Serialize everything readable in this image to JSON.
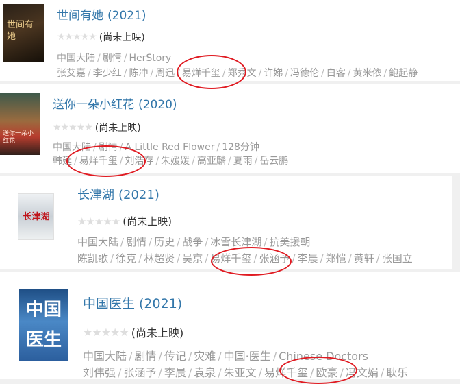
{
  "movies": [
    {
      "title": "世间有她",
      "year": "(2021)",
      "poster_text": "世间有她",
      "stars": "★★★★★",
      "status": "(尚未上映)",
      "meta": [
        "中国大陆",
        "剧情",
        "HerStory"
      ],
      "cast": [
        "张艾嘉",
        "李少红",
        "陈冲",
        "周迅",
        "易烊千玺",
        "郑秀文",
        "许娣",
        "冯德伦",
        "白客",
        "黄米依",
        "鲍起静"
      ]
    },
    {
      "title": "送你一朵小红花",
      "year": "(2020)",
      "poster_text": "送你一朵小红花",
      "stars": "★★★★★",
      "status": "(尚未上映)",
      "meta": [
        "中国大陆",
        "剧情",
        "A Little Red Flower",
        "128分钟"
      ],
      "cast": [
        "韩延",
        "易烊千玺",
        "刘浩存",
        "朱媛媛",
        "高亚麟",
        "夏雨",
        "岳云鹏"
      ]
    },
    {
      "title": "长津湖",
      "year": "(2021)",
      "poster_text": "长津湖",
      "stars": "★★★★★",
      "status": "(尚未上映)",
      "meta": [
        "中国大陆",
        "剧情",
        "历史",
        "战争",
        "冰雪长津湖",
        "抗美援朝"
      ],
      "cast": [
        "陈凯歌",
        "徐克",
        "林超贤",
        "吴京",
        "易烊千玺",
        "张涵予",
        "李晨",
        "郑恺",
        "黄轩",
        "张国立"
      ]
    },
    {
      "title": "中国医生",
      "year": "(2021)",
      "poster_text": "中国医生",
      "stars": "★★★★★",
      "status": "(尚未上映)",
      "meta": [
        "中国大陆",
        "剧情",
        "传记",
        "灾难",
        "中国·医生",
        "Chinese Doctors"
      ],
      "cast": [
        "刘伟强",
        "张涵予",
        "李晨",
        "袁泉",
        "朱亚文",
        "易烊千玺",
        "欧豪",
        "冯文娟",
        "耿乐"
      ]
    }
  ],
  "colors": {
    "title": "#3377aa",
    "meta_text": "#999999",
    "star_empty": "#dedede",
    "highlight": "#e01b22"
  }
}
